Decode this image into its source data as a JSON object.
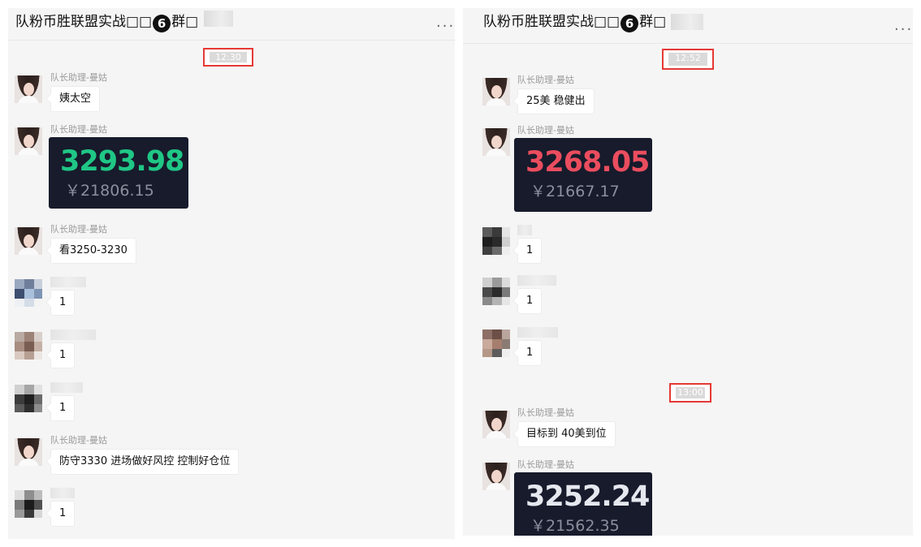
{
  "colors": {
    "price_up": "#1fc785",
    "price_down": "#ea4d5e",
    "price_neutral": "#e6e8f0",
    "highlight_box": "#e53935"
  },
  "left": {
    "title_prefix": "队粉币胜联盟实战□□",
    "title_circle": "6",
    "title_suffix": "群□",
    "more": "...",
    "time": "12:30",
    "messages": [
      {
        "sender": "队长助理-曼姑",
        "text": "姨太空"
      },
      {
        "sender": "队长助理-曼姑",
        "price": "3293.98",
        "price_cny": "￥21806.15",
        "price_color": "up"
      },
      {
        "sender": "队长助理-曼姑",
        "text": "看3250-3230"
      },
      {
        "text": "1"
      },
      {
        "text": "1"
      },
      {
        "text": "1"
      },
      {
        "sender": "队长助理-曼姑",
        "text": "防守3330    进场做好风控  控制好仓位"
      },
      {
        "text": "1"
      }
    ]
  },
  "right": {
    "title_prefix": "队粉币胜联盟实战□□",
    "title_circle": "6",
    "title_suffix": "群□",
    "more": "...",
    "time_1": "12:52",
    "time_2": "13:00",
    "messages": [
      {
        "sender": "队长助理-曼姑",
        "text": "25美  稳健出"
      },
      {
        "sender": "队长助理-曼姑",
        "price": "3268.05",
        "price_cny": "￥21667.17",
        "price_color": "down"
      },
      {
        "text": "1"
      },
      {
        "text": "1"
      },
      {
        "text": "1"
      },
      {
        "sender": "队长助理-曼姑",
        "text": "目标到    40美到位"
      },
      {
        "sender": "队长助理-曼姑",
        "price": "3252.24",
        "price_cny": "￥21562.35",
        "price_color": "neutral"
      }
    ]
  }
}
